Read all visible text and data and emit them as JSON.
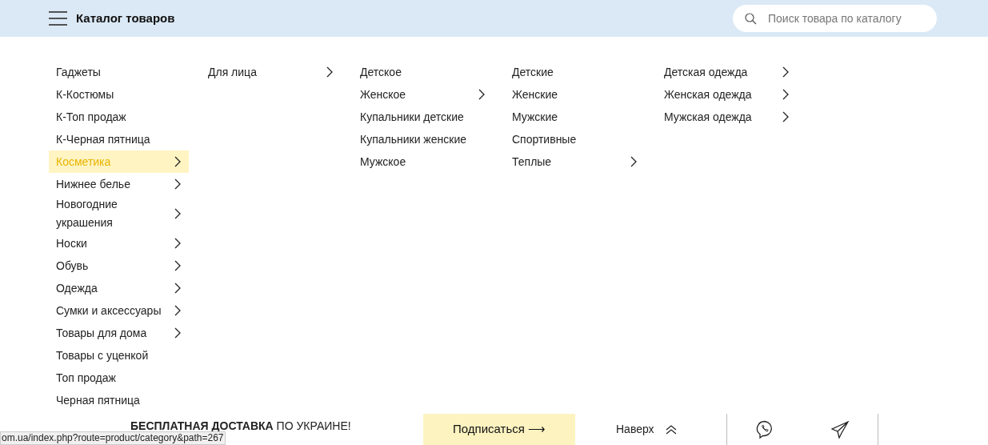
{
  "header": {
    "title": "Каталог товаров",
    "search": {
      "placeholder": "Поиск товара по каталогу"
    }
  },
  "menu_columns": [
    {
      "items": [
        {
          "label": "Гаджеты",
          "has_children": false,
          "selected": false
        },
        {
          "label": "К-Костюмы",
          "has_children": false,
          "selected": false
        },
        {
          "label": "К-Топ продаж",
          "has_children": false,
          "selected": false
        },
        {
          "label": "К-Черная пятница",
          "has_children": false,
          "selected": false
        },
        {
          "label": "Косметика",
          "has_children": true,
          "selected": true
        },
        {
          "label": "Нижнее белье",
          "has_children": true,
          "selected": false
        },
        {
          "label": "Новогодние украшения",
          "has_children": true,
          "selected": false
        },
        {
          "label": "Носки",
          "has_children": true,
          "selected": false
        },
        {
          "label": "Обувь",
          "has_children": true,
          "selected": false
        },
        {
          "label": "Одежда",
          "has_children": true,
          "selected": false
        },
        {
          "label": "Сумки и аксессуары",
          "has_children": true,
          "selected": false
        },
        {
          "label": "Товары для дома",
          "has_children": true,
          "selected": false
        },
        {
          "label": "Товары с уценкой",
          "has_children": false,
          "selected": false
        },
        {
          "label": "Топ продаж",
          "has_children": false,
          "selected": false
        },
        {
          "label": "Черная пятница",
          "has_children": false,
          "selected": false
        }
      ]
    },
    {
      "items": [
        {
          "label": "Для лица",
          "has_children": true,
          "selected": false
        }
      ]
    },
    {
      "items": [
        {
          "label": "Детское",
          "has_children": false,
          "selected": false
        },
        {
          "label": "Женское",
          "has_children": true,
          "selected": false
        },
        {
          "label": "Купальники детские",
          "has_children": false,
          "selected": false
        },
        {
          "label": "Купальники женские",
          "has_children": false,
          "selected": false
        },
        {
          "label": "Мужское",
          "has_children": false,
          "selected": false
        }
      ]
    },
    {
      "items": [
        {
          "label": "Детские",
          "has_children": false,
          "selected": false
        },
        {
          "label": "Женские",
          "has_children": false,
          "selected": false
        },
        {
          "label": "Мужские",
          "has_children": false,
          "selected": false
        },
        {
          "label": "Спортивные",
          "has_children": false,
          "selected": false
        },
        {
          "label": "Теплые",
          "has_children": true,
          "selected": false
        }
      ]
    },
    {
      "items": [
        {
          "label": "Детская одежда",
          "has_children": true,
          "selected": false
        },
        {
          "label": "Женская одежда",
          "has_children": true,
          "selected": false
        },
        {
          "label": "Мужская одежда",
          "has_children": true,
          "selected": false
        }
      ]
    }
  ],
  "footer": {
    "promo": "**БЕСПЛАТНАЯ ДОСТАВКА** ПО УКРАИНЕ!",
    "subscribe_button": "Подписаться ⟶",
    "to_top": "Наверх"
  },
  "status_bar": {
    "url": "om.ua/index.php?route=product/category&path=267"
  }
}
